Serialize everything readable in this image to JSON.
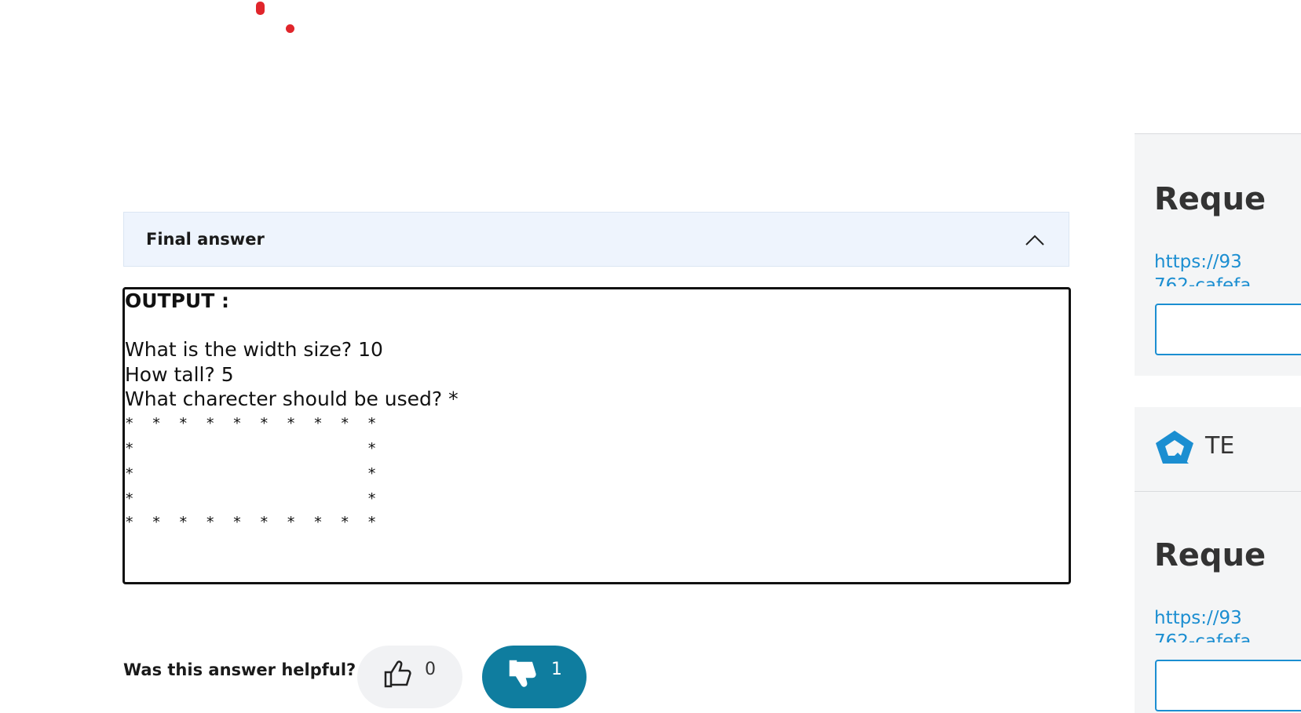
{
  "final_answer": {
    "header_title": "Final answer"
  },
  "output": {
    "title": "OUTPUT :",
    "lines": [
      "What is the width size? 10",
      "How tall? 5",
      "What charecter should be used? *"
    ],
    "pattern_rows": [
      "*  *  *  *  *  *  *  *  *  *",
      "*                          *",
      "*                          *",
      "*                          *",
      "*  *  *  *  *  *  *  *  *  *"
    ]
  },
  "feedback": {
    "question": "Was this answer helpful?",
    "upvotes": "0",
    "downvotes": "1"
  },
  "sidebar": {
    "request_title_1": "Reque",
    "request_link_1": "https://93",
    "request_link_1b": "762-cafefa",
    "te_label": "TE",
    "request_title_2": "Reque",
    "request_link_2": "https://93",
    "request_link_2b": "762-cafefa"
  },
  "colors": {
    "accent": "#0f7d9f",
    "link": "#1b8ed1",
    "header_bg": "#eef4fd",
    "dot": "#e0252b"
  }
}
